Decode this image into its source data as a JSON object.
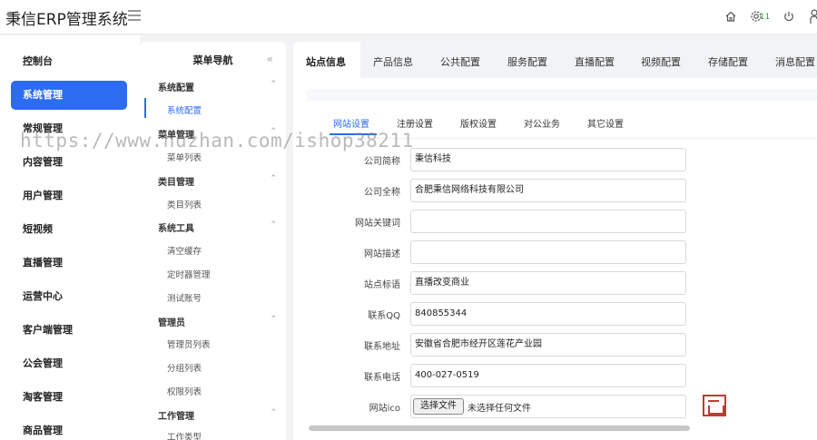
{
  "app": {
    "title": "秉信ERP管理系统",
    "notification_count": "11"
  },
  "sidebar": {
    "items": [
      {
        "label": "控制台"
      },
      {
        "label": "系统管理"
      },
      {
        "label": "常规管理"
      },
      {
        "label": "内容管理"
      },
      {
        "label": "用户管理"
      },
      {
        "label": "短视频"
      },
      {
        "label": "直播管理"
      },
      {
        "label": "运营中心"
      },
      {
        "label": "客户端管理"
      },
      {
        "label": "公会管理"
      },
      {
        "label": "淘客管理"
      },
      {
        "label": "商品管理"
      }
    ]
  },
  "submenu": {
    "title": "菜单导航",
    "groups": [
      {
        "label": "系统配置",
        "items": [
          "系统配置"
        ]
      },
      {
        "label": "菜单管理",
        "items": [
          "菜单列表"
        ]
      },
      {
        "label": "类目管理",
        "items": [
          "类目列表"
        ]
      },
      {
        "label": "系统工具",
        "items": [
          "清空缓存",
          "定时器管理",
          "测试账号"
        ]
      },
      {
        "label": "管理员",
        "items": [
          "管理员列表",
          "分组列表",
          "权限列表"
        ]
      },
      {
        "label": "工作管理",
        "items": [
          "工作类型"
        ]
      }
    ]
  },
  "tabs": [
    "站点信息",
    "产品信息",
    "公共配置",
    "服务配置",
    "直播配置",
    "视频配置",
    "存储配置",
    "消息配置"
  ],
  "subtabs": [
    "网站设置",
    "注册设置",
    "版权设置",
    "对公业务",
    "其它设置"
  ],
  "form": {
    "fields": [
      {
        "label": "公司简称",
        "value": "秉信科技"
      },
      {
        "label": "公司全称",
        "value": "合肥秉信网络科技有限公司"
      },
      {
        "label": "网站关键词",
        "value": ""
      },
      {
        "label": "网站描述",
        "value": ""
      },
      {
        "label": "站点标语",
        "value": "直播改变商业"
      },
      {
        "label": "联系QQ",
        "value": "840855344"
      },
      {
        "label": "联系地址",
        "value": "安徽省合肥市经开区莲花产业园"
      },
      {
        "label": "联系电话",
        "value": "400-027-0519"
      }
    ],
    "ico": {
      "label": "网站ico",
      "button": "选择文件",
      "status": "未选择任何文件"
    }
  },
  "watermark": "https://www.huzhan.com/ishop38211",
  "colors": {
    "accent": "#2d6cf0",
    "badge": "#2ca24c",
    "logo": "#c03a32"
  }
}
